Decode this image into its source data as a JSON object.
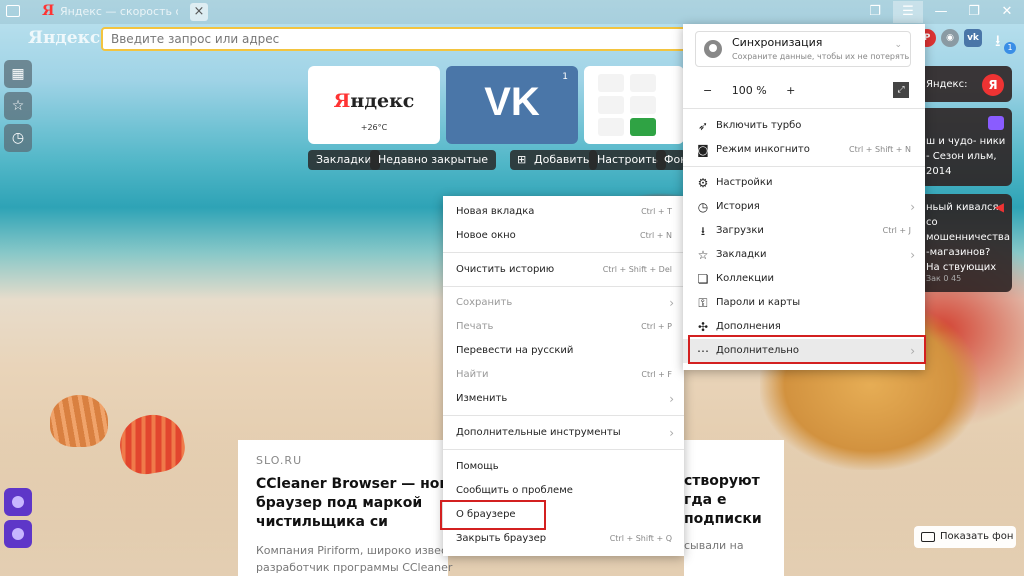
{
  "browser": {
    "tab_title": "Яндекс — скорость соед",
    "tab_close": "×",
    "logo": "Яндекс",
    "omnibox_placeholder": "Введите запрос или адрес",
    "download_badge": "1"
  },
  "tiles": {
    "yandex": {
      "name_ya": "Я",
      "name_rest": "ндекс",
      "weather": "+26°C"
    },
    "vk": {
      "logo": "VK",
      "count": "1"
    }
  },
  "tile_buttons": {
    "bookmarks": "Закладки",
    "recently_closed": "Недавно закрытые",
    "add": "Добавить",
    "customize": "Настроить",
    "background": "Фон"
  },
  "news": {
    "source": "SLO.RU",
    "title": "CCleaner Browser — новый браузер под маркой чистильщика си",
    "text": "Компания Piriform, широко известный разработчик программы CCleaner",
    "right_title": "створуют гда е подписки",
    "right_text": "сывали на"
  },
  "zen": [
    {
      "text": "Яндекс:"
    },
    {
      "text": "ш и чудо- ники - Сезон ильм, 2014"
    },
    {
      "text": "ньый кивался со мошенничества -магазинов? На ствующих",
      "meta": "Зак   0   45"
    }
  ],
  "show_background": "Показать фон",
  "context_menu": [
    {
      "label": "Новая вкладка",
      "shortcut": "Ctrl + T"
    },
    {
      "label": "Новое окно",
      "shortcut": "Ctrl + N"
    },
    {
      "label": "Очистить историю",
      "shortcut": "Ctrl + Shift + Del"
    },
    {
      "label": "Сохранить",
      "shortcut": "›"
    },
    {
      "label": "Печать",
      "shortcut": "Ctrl + P"
    },
    {
      "label": "Перевести на русский",
      "shortcut": ""
    },
    {
      "label": "Найти",
      "shortcut": "Ctrl + F"
    },
    {
      "label": "Изменить",
      "shortcut": "›"
    },
    {
      "label": "Дополнительные инструменты",
      "shortcut": "›"
    },
    {
      "label": "Помощь",
      "shortcut": ""
    },
    {
      "label": "Сообщить о проблеме",
      "shortcut": ""
    },
    {
      "label": "О браузере",
      "shortcut": ""
    },
    {
      "label": "Закрыть браузер",
      "shortcut": "Ctrl + Shift + Q"
    }
  ],
  "main_menu": {
    "sync_title": "Синхронизация",
    "sync_subtitle": "Сохраните данные, чтобы их не потерять",
    "zoom_minus": "−",
    "zoom_value": "100 %",
    "zoom_plus": "+",
    "items": [
      {
        "label": "Включить турбо",
        "shortcut": ""
      },
      {
        "label": "Режим инкогнито",
        "shortcut": "Ctrl + Shift + N"
      },
      {
        "label": "Настройки",
        "shortcut": ""
      },
      {
        "label": "История",
        "shortcut": "›"
      },
      {
        "label": "Загрузки",
        "shortcut": "Ctrl + J"
      },
      {
        "label": "Закладки",
        "shortcut": "›"
      },
      {
        "label": "Коллекции",
        "shortcut": ""
      },
      {
        "label": "Пароли и карты",
        "shortcut": ""
      },
      {
        "label": "Дополнения",
        "shortcut": ""
      },
      {
        "label": "Дополнительно",
        "shortcut": "›"
      }
    ]
  },
  "colors": {
    "highlight": "#d32020",
    "omnibox_border": "#f3c43f",
    "vk": "#4a76a8"
  }
}
